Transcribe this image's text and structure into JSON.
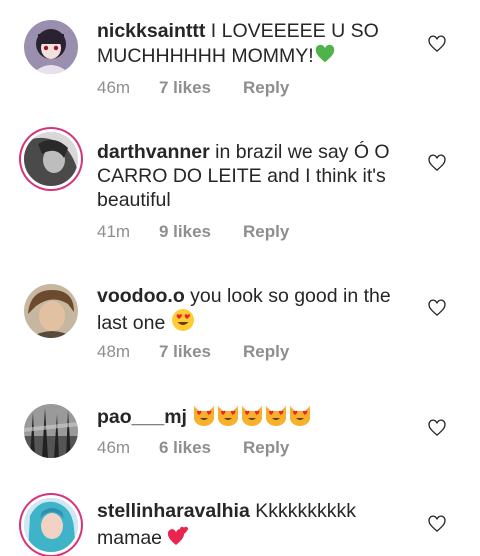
{
  "accent_color": "#d8327a",
  "comments": [
    {
      "username": "nickksainttt",
      "text": "I LOVEEEEE U SO MUCHHHHHH MOMMY!",
      "emoji": "green-heart",
      "time": "46m",
      "likes": "7 likes",
      "reply": "Reply"
    },
    {
      "username": "darthvanner",
      "text": "in brazil we say Ó O CARRO DO LEITE and I think it's beautiful",
      "time": "41m",
      "likes": "9 likes",
      "reply": "Reply"
    },
    {
      "username": "voodoo.o",
      "text": "you look so good in the last one",
      "emoji": "heart-eyes",
      "time": "48m",
      "likes": "7 likes",
      "reply": "Reply"
    },
    {
      "username": "pao___mj",
      "text": "",
      "emoji": "heart-eyes-cat x5",
      "time": "46m",
      "likes": "6 likes",
      "reply": "Reply"
    },
    {
      "username": "stellinharavalhia",
      "text": "Kkkkkkkkkk mamae",
      "emoji": "two-hearts"
    }
  ]
}
